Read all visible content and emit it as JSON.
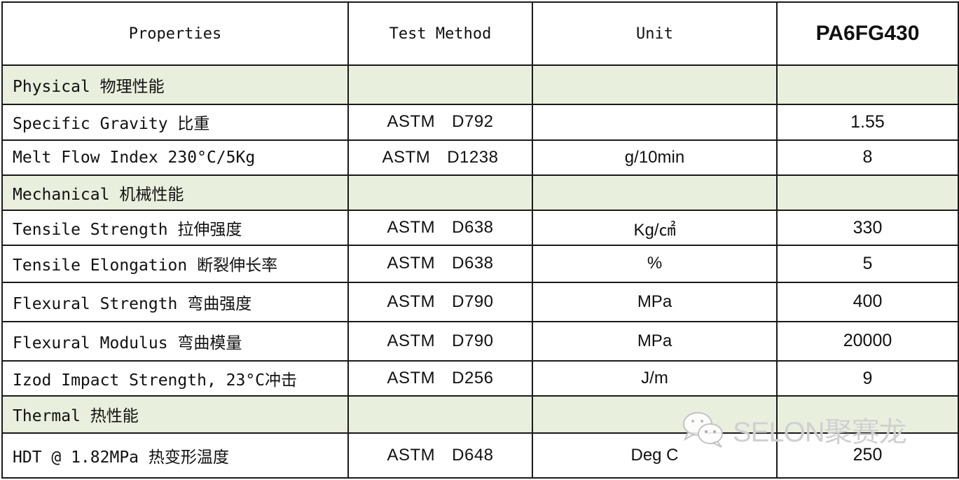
{
  "table": {
    "headers": {
      "properties": "Properties",
      "test_method": "Test Method",
      "unit": "Unit",
      "product": "PA6FG430"
    },
    "rows": [
      {
        "type": "section",
        "label": "Physical 物理性能"
      },
      {
        "type": "data",
        "property": "Specific Gravity 比重",
        "method_std": "ASTM",
        "method_code": "D792",
        "unit": "",
        "value": "1.55"
      },
      {
        "type": "data",
        "property": "Melt Flow Index 230°C/5Kg",
        "method_std": "ASTM",
        "method_code": "D1238",
        "unit": "g/10min",
        "value": "8"
      },
      {
        "type": "section",
        "label": "Mechanical 机械性能"
      },
      {
        "type": "data",
        "property": "Tensile Strength 拉伸强度",
        "method_std": "ASTM",
        "method_code": "D638",
        "unit": "Kg/㎠",
        "value": "330"
      },
      {
        "type": "data",
        "property": "Tensile Elongation 断裂伸长率",
        "method_std": "ASTM",
        "method_code": "D638",
        "unit": "%",
        "value": "5"
      },
      {
        "type": "data",
        "property": "Flexural Strength 弯曲强度",
        "method_std": "ASTM",
        "method_code": "D790",
        "unit": "MPa",
        "value": "400"
      },
      {
        "type": "data",
        "property": "Flexural Modulus 弯曲模量",
        "method_std": "ASTM",
        "method_code": "D790",
        "unit": "MPa",
        "value": "20000"
      },
      {
        "type": "data",
        "property": "Izod Impact Strength, 23°C冲击",
        "method_std": "ASTM",
        "method_code": "D256",
        "unit": "J/m",
        "value": "9"
      },
      {
        "type": "section",
        "label": "Thermal 热性能"
      },
      {
        "type": "data",
        "property": "HDT @ 1.82MPa  热变形温度",
        "method_std": "ASTM",
        "method_code": "D648",
        "unit": "Deg C",
        "value": "250"
      }
    ]
  },
  "watermark": {
    "icon": "wechat-icon",
    "text": "SELON聚赛龙"
  },
  "colors": {
    "section_bg": "#e9efdd",
    "border": "#1a1a1a"
  }
}
